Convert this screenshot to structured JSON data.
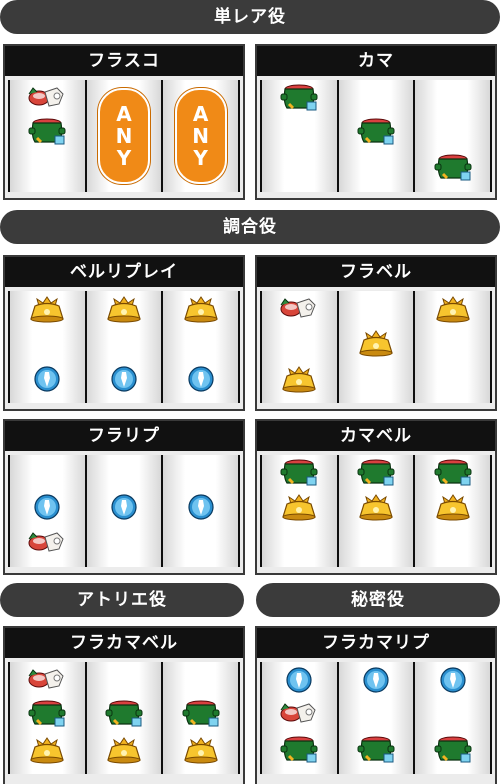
{
  "sections": {
    "rare": "単レア役",
    "choai": "調合役",
    "atelier": "アトリエ役",
    "secret": "秘密役"
  },
  "panels": {
    "frasco": "フラスコ",
    "kama": "カマ",
    "bell_replay": "ベルリプレイ",
    "fra_bell": "フラベル",
    "fra_rip": "フラリプ",
    "kama_bell": "カマベル",
    "fra_kama_bell": "フラカマベル",
    "fra_kama_rip": "フラカマリプ"
  },
  "any": {
    "a": "A",
    "n": "N",
    "y": "Y"
  },
  "any2": {
    "a": "A",
    "n": "N",
    "y": "Y"
  },
  "colors": {
    "header_bg": "#3b3b3b",
    "panel_title_bg": "#111111",
    "any": "#f08a17",
    "bell": "#f2b321",
    "kama": "#1f7a2e",
    "replay": "#2a8fcf"
  }
}
